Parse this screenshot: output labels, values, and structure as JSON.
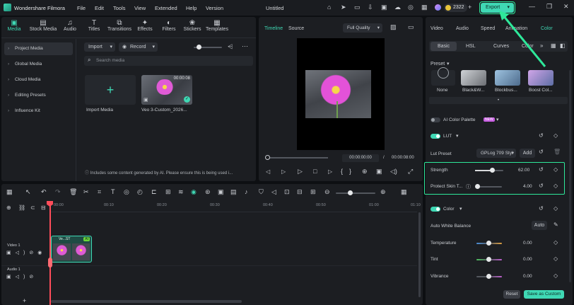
{
  "app": {
    "name": "Wondershare Filmora",
    "project_title": "Untitled"
  },
  "menu": [
    "File",
    "Edit",
    "Tools",
    "View",
    "Extended",
    "Help",
    "Version"
  ],
  "credits": "2322",
  "export_label": "Export",
  "media_tabs": [
    {
      "label": "Media",
      "icon": "media-icon"
    },
    {
      "label": "Stock Media",
      "icon": "stock-media-icon"
    },
    {
      "label": "Audio",
      "icon": "audio-icon"
    },
    {
      "label": "Titles",
      "icon": "titles-icon"
    },
    {
      "label": "Transitions",
      "icon": "transitions-icon"
    },
    {
      "label": "Effects",
      "icon": "effects-icon"
    },
    {
      "label": "Filters",
      "icon": "filters-icon"
    },
    {
      "label": "Stickers",
      "icon": "stickers-icon"
    },
    {
      "label": "Templates",
      "icon": "templates-icon"
    }
  ],
  "sidebar": [
    "Project Media",
    "Global Media",
    "Cloud Media",
    "Editing Presets",
    "Influence Kit"
  ],
  "media_toolbar": {
    "import": "Import",
    "record": "Record",
    "search_placeholder": "Search media"
  },
  "media_items": {
    "import_label": "Import Media",
    "clip_label": "Veo 3-Custom_2026...",
    "clip_duration": "00:00:08"
  },
  "ai_notice": "Includes some content generated by AI. Please ensure this is being used i...",
  "preview": {
    "tab_timeline": "Timeline",
    "tab_source": "Source",
    "quality": "Full Quality",
    "time_current": "00:00:00:00",
    "time_total": "00:00:08:00"
  },
  "right_tabs": [
    "Video",
    "Audio",
    "Speed",
    "Animation",
    "Color"
  ],
  "color_subtabs": [
    "Basic",
    "HSL",
    "Curves",
    "Color"
  ],
  "preset": {
    "label": "Preset",
    "items": [
      "None",
      "Black&W...",
      "Blockbus...",
      "Boost Col..."
    ]
  },
  "ai_palette": {
    "label": "AI Color Palette",
    "badge": "NEW"
  },
  "lut": {
    "label": "LUT",
    "preset_label": "Lut Preset",
    "preset_value": "GPLog 709 Styl",
    "add": "Add"
  },
  "strength": {
    "label": "Strength",
    "value": "62.00",
    "level": 0.62
  },
  "protect": {
    "label": "Protect Skin T...",
    "value": "4.00",
    "level": 0.04
  },
  "color": {
    "label": "Color",
    "awb_label": "Auto White Balance",
    "auto": "Auto"
  },
  "adjust": [
    {
      "label": "Temperature",
      "value": "0.00"
    },
    {
      "label": "Tint",
      "value": "0.00"
    },
    {
      "label": "Vibrance",
      "value": "0.00"
    }
  ],
  "footer": {
    "reset": "Reset",
    "save": "Save as Custom"
  },
  "ruler": [
    "00:00",
    "00:10",
    "00:20",
    "00:30",
    "00:40",
    "00:50",
    "01:00",
    "01:10"
  ],
  "tracks": {
    "video": "Video 1",
    "audio": "Audio 1"
  },
  "clip": {
    "label": "Ve...ST",
    "ai": "AI"
  },
  "colors": {
    "accent": "#3fd8b4",
    "export_bg": "#3fd8b4",
    "highlight": "#2ee89a"
  }
}
